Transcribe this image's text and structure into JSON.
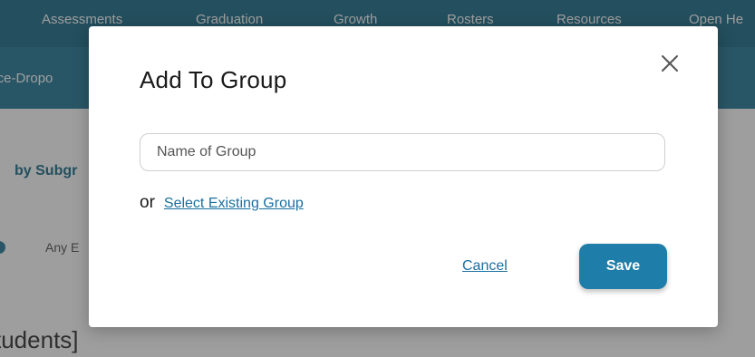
{
  "background": {
    "nav_items": [
      "Assessments",
      "Graduation",
      "Growth",
      "Rosters",
      "Resources",
      "Open He"
    ],
    "sub_nav_text": "ance-Dropo",
    "subgroup_label": "by Subgr",
    "any_label": "Any E",
    "students_label": "tudents]"
  },
  "modal": {
    "title": "Add To Group",
    "name_input": {
      "value": "",
      "placeholder": "Name of Group"
    },
    "or_text": "or",
    "select_existing_label": "Select Existing Group",
    "cancel_label": "Cancel",
    "save_label": "Save",
    "close_icon": "close-icon"
  },
  "colors": {
    "nav_bg": "#1f6f8b",
    "accent": "#1f7ea9",
    "link": "#1a6fa0"
  }
}
